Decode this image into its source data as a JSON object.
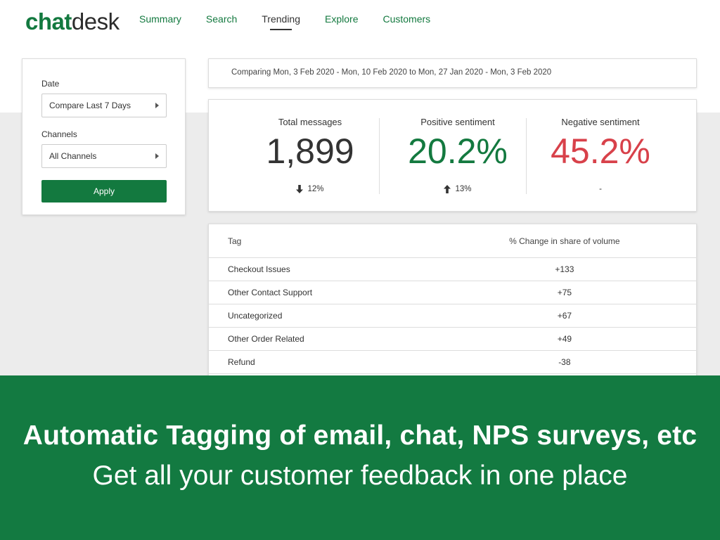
{
  "header": {
    "logo_part1": "chat",
    "logo_part2": "desk",
    "nav": [
      "Summary",
      "Search",
      "Trending",
      "Explore",
      "Customers"
    ],
    "active_nav": "Trending"
  },
  "filters": {
    "date_label": "Date",
    "date_value": "Compare Last 7 Days",
    "channels_label": "Channels",
    "channels_value": "All Channels",
    "apply_label": "Apply"
  },
  "comparing_text": "Comparing Mon, 3 Feb 2020 - Mon, 10 Feb 2020 to Mon, 27 Jan 2020 - Mon, 3 Feb 2020",
  "stats": [
    {
      "title": "Total messages",
      "value": "1,899",
      "change": "12%",
      "direction": "down",
      "color": "#333333"
    },
    {
      "title": "Positive sentiment",
      "value": "20.2%",
      "change": "13%",
      "direction": "up",
      "color": "#13793f"
    },
    {
      "title": "Negative sentiment",
      "value": "45.2%",
      "change": "-",
      "direction": "none",
      "color": "#d8414a"
    }
  ],
  "table": {
    "headers": [
      "Tag",
      "% Change in share of volume"
    ],
    "rows": [
      [
        "Checkout Issues",
        "+133"
      ],
      [
        "Other Contact Support",
        "+75"
      ],
      [
        "Uncategorized",
        "+67"
      ],
      [
        "Other Order Related",
        "+49"
      ],
      [
        "Refund",
        "-38"
      ]
    ]
  },
  "banner": {
    "title": "Automatic Tagging of email, chat, NPS surveys, etc",
    "subtitle": "Get all your customer feedback in one place"
  },
  "colors": {
    "brand_green": "#13793f",
    "negative_red": "#d8414a"
  }
}
